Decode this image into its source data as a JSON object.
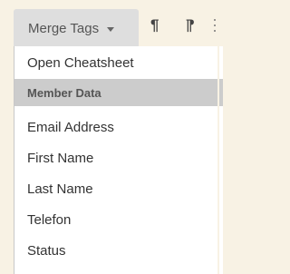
{
  "toolbar": {
    "merge_tags_label": "Merge Tags",
    "icons": [
      "chevron-down-icon",
      "paragraph-ltr-icon",
      "paragraph-rtl-icon",
      "more-vertical-icon"
    ]
  },
  "dropdown": {
    "cheatsheet_label": "Open Cheatsheet",
    "section_header": "Member Data",
    "items": [
      "Email Address",
      "First Name",
      "Last Name",
      "Telefon",
      "Status"
    ]
  },
  "colors": {
    "background": "#f8f2e4",
    "button": "#dedede",
    "header": "#cccccc",
    "menu": "#ffffff"
  }
}
